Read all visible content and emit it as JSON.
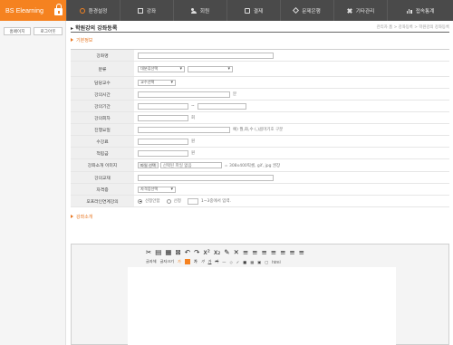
{
  "app": {
    "brand": "BS Elearning"
  },
  "nav": [
    {
      "label": "환경설정",
      "icon": "gear-icon"
    },
    {
      "label": "강좌",
      "icon": "edit-icon"
    },
    {
      "label": "회원",
      "icon": "users-icon"
    },
    {
      "label": "결제",
      "icon": "payment-icon"
    },
    {
      "label": "문제은행",
      "icon": "diamond-icon"
    },
    {
      "label": "기타관리",
      "icon": "tools-icon"
    },
    {
      "label": "접속통계",
      "icon": "bar-chart-icon"
    }
  ],
  "sidebar": {
    "home_label": "홈페이지",
    "logout_label": "로그아웃"
  },
  "page": {
    "title": "▸ 학원강의 강좌등록",
    "breadcrumb": "관리자 홈 > 강좌등록 > 학원강의 강좌등록"
  },
  "sections": {
    "basic": "기본정보",
    "intro": "강좌소개"
  },
  "form": {
    "name_label": "강좌명",
    "category_label": "분류",
    "category_value": "대분류선택",
    "teacher_label": "담당교수",
    "teacher_value": "교수선택",
    "time_label": "강의시간",
    "time_unit": "분",
    "period_label": "강의기간",
    "period_sep": "~",
    "count_label": "강의회차",
    "count_unit": "회",
    "day_label": "진행요일",
    "day_hint": "예) 월,화,수 (,)콤마기호 구분",
    "fee_label": "수강료",
    "fee_unit": "원",
    "reserve_label": "적립금",
    "reserve_unit": "원",
    "image_label": "강좌소개 이미지",
    "file_button": "파일 선택",
    "file_status": "선택된 파일 없음",
    "image_hint": "= 308x400픽셀, gif, jpg 권장",
    "book_label": "강의교재",
    "qual_label": "자격증",
    "qual_value": "자격증선택",
    "offline_label": "오프라인연계강의",
    "offline_opt1": "선정안함",
    "offline_opt2": "선정",
    "offline_hint": "1~3중에서 입력."
  },
  "editor": {
    "toolbar1": [
      "✂",
      "▤",
      "▦",
      "⊠",
      "↶",
      "↷",
      "x²",
      "x₂",
      "✎",
      "✕",
      "≡",
      "≡",
      "≡",
      "≡",
      "≡",
      "≡",
      "≡"
    ],
    "toolbar2": [
      "글자체",
      "글자크기",
      "가",
      "가",
      "가",
      "가",
      "가",
      "—",
      "◇",
      "✓",
      "■",
      "▦",
      "▣",
      "▢",
      "html"
    ]
  }
}
